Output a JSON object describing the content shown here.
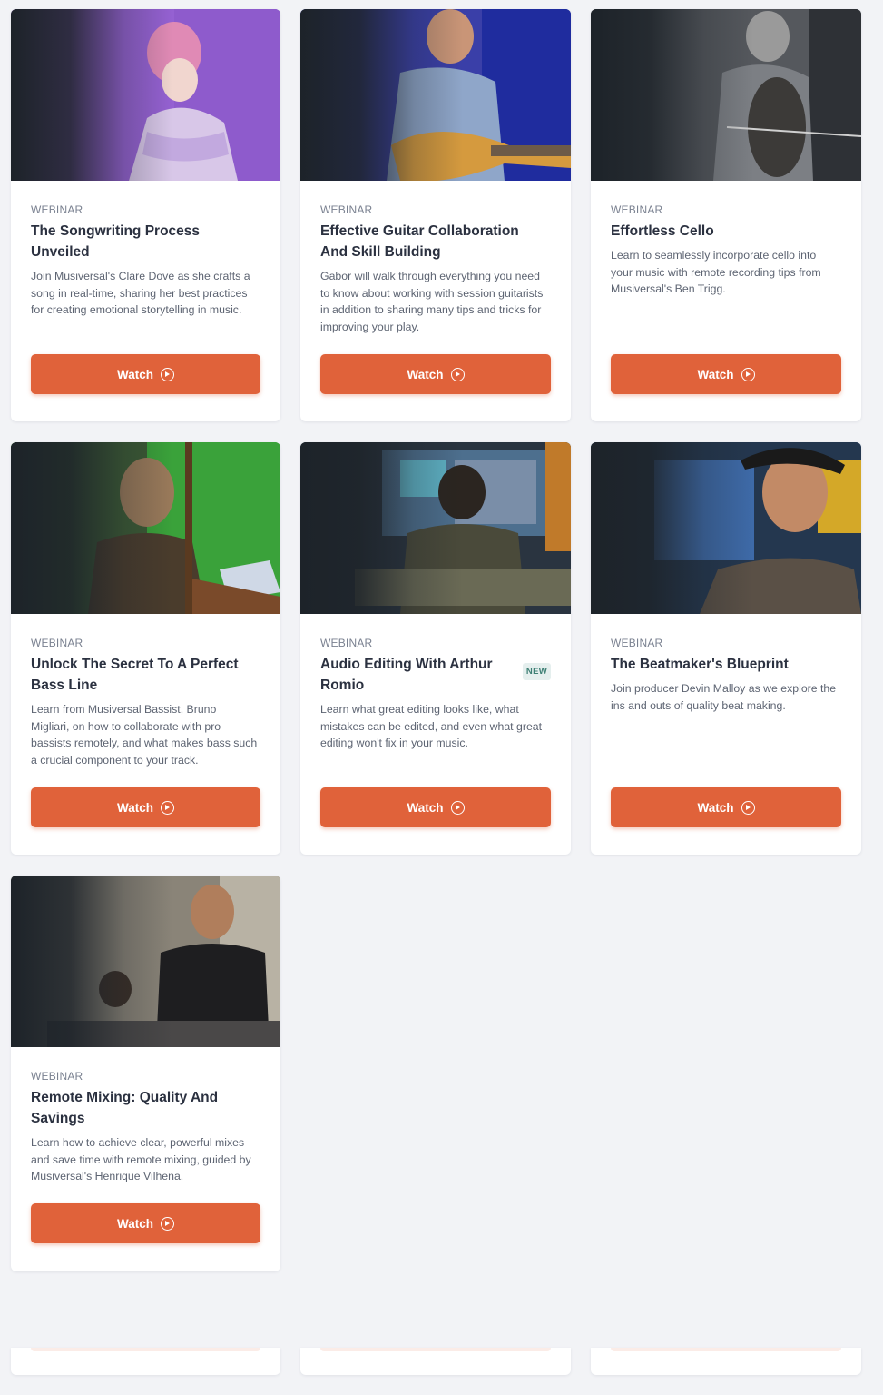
{
  "cards": [
    {
      "kicker": "WEBINAR",
      "title": "The Songwriting Process Unveiled",
      "badge": "",
      "description": "Join Musiversal's Clare Dove as she crafts a song in real-time, sharing her best practices for creating emotional storytelling in music.",
      "button": "Watch",
      "image_tone": "#8a5ac8"
    },
    {
      "kicker": "WEBINAR",
      "title": "Effective Guitar Collaboration And Skill Building",
      "badge": "",
      "description": "Gabor will walk through everything you need to know about working with session guitarists in addition to sharing many tips and tricks for improving your play.",
      "button": "Watch",
      "image_tone": "#2b3fb0"
    },
    {
      "kicker": "WEBINAR",
      "title": "Effortless Cello",
      "badge": "",
      "description": "Learn to seamlessly incorporate cello into your music with remote recording tips from Musiversal's Ben Trigg.",
      "button": "Watch",
      "image_tone": "#5a5d62"
    },
    {
      "kicker": "WEBINAR",
      "title": "Unlock The Secret To A Perfect Bass Line",
      "badge": "",
      "description": "Learn from Musiversal Bassist, Bruno Migliari, on how to collaborate with pro bassists remotely, and what makes bass such a crucial component to your track.",
      "button": "Watch",
      "image_tone": "#3f9a3a"
    },
    {
      "kicker": "WEBINAR",
      "title": "Audio Editing With Arthur Romio",
      "badge": "NEW",
      "description": "Learn what great editing looks like, what mistakes can be edited, and even what great editing won't fix in your music.",
      "button": "Watch",
      "image_tone": "#4a6a8a"
    },
    {
      "kicker": "WEBINAR",
      "title": "The Beatmaker's Blueprint",
      "badge": "",
      "description": "Join producer Devin Malloy as we explore the ins and outs of quality beat making.",
      "button": "Watch",
      "image_tone": "#2d5a9a"
    },
    {
      "kicker": "WEBINAR",
      "title": "Remote Mixing: Quality And Savings",
      "badge": "",
      "description": "Learn how to achieve clear, powerful mixes and save time with remote mixing, guided by Musiversal's Henrique Vilhena.",
      "button": "Watch",
      "image_tone": "#7a6a5a"
    }
  ]
}
